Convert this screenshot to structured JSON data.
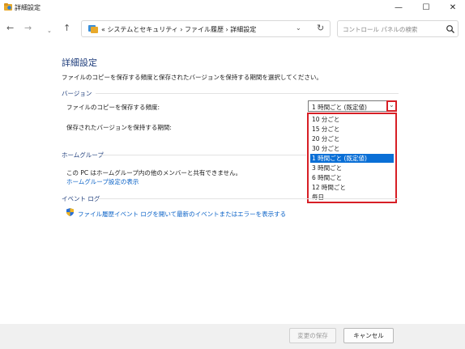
{
  "window": {
    "title": "詳細設定",
    "minimize_glyph": "—",
    "maximize_glyph": "☐",
    "close_glyph": "✕"
  },
  "nav": {
    "back_glyph": "←",
    "forward_glyph": "→",
    "recent_glyph": "⌄",
    "up_glyph": "↑",
    "breadcrumb": "« システムとセキュリティ › ファイル履歴 › 詳細設定",
    "chevron_glyph": "⌄",
    "refresh_glyph": "↻",
    "search_placeholder": "コントロール パネルの検索"
  },
  "main": {
    "title": "詳細設定",
    "instruction": "ファイルのコピーを保存する頻度と保存されたバージョンを保持する期間を選択してください。",
    "versions_group": {
      "header": "バージョン",
      "frequency_label": "ファイルのコピーを保存する頻度:",
      "frequency_selected": "1 時間ごと (既定値)",
      "keep_label": "保存されたバージョンを保持する期間:",
      "frequency_options": [
        "10 分ごと",
        "15 分ごと",
        "20 分ごと",
        "30 分ごと",
        "1 時間ごと (既定値)",
        "3 時間ごと",
        "6 時間ごと",
        "12 時間ごと",
        "毎日"
      ],
      "highlighted_option_index": 4
    },
    "homegroup_group": {
      "header": "ホームグループ",
      "message": "この PC はホームグループ内の他のメンバーと共有できません。",
      "link": "ホームグループ設定の表示"
    },
    "eventlog_group": {
      "header": "イベント ログ",
      "link": "ファイル履歴イベント ログを開いて最新のイベントまたはエラーを表示する"
    }
  },
  "footer": {
    "save_label": "変更の保存",
    "cancel_label": "キャンセル"
  },
  "colors": {
    "heading": "#1e3d7b",
    "link": "#0a62c7",
    "highlight": "#d71f26",
    "selection": "#0a6fd6"
  }
}
